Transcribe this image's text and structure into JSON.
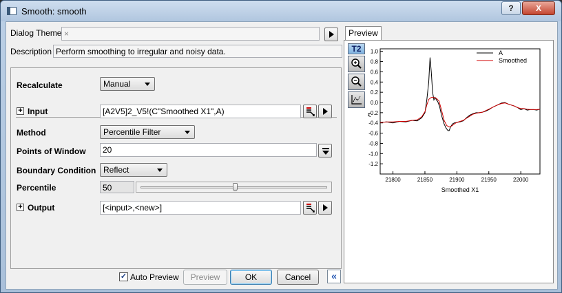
{
  "window": {
    "title": "Smooth: smooth"
  },
  "titlebar": {
    "help_label": "?",
    "close_label": "X"
  },
  "dialog_theme": {
    "label": "Dialog Theme",
    "value": "×"
  },
  "description": {
    "label": "Description",
    "value": "Perform smoothing to irregular and noisy data."
  },
  "recalculate": {
    "label": "Recalculate",
    "value": "Manual"
  },
  "input": {
    "label": "Input",
    "value": "[A2V5]2_V5!(C\"Smoothed X1\",A)"
  },
  "method": {
    "label": "Method",
    "value": "Percentile Filter"
  },
  "points_of_window": {
    "label": "Points of Window",
    "value": "20"
  },
  "boundary": {
    "label": "Boundary Condition",
    "value": "Reflect"
  },
  "percentile": {
    "label": "Percentile",
    "value": "50",
    "slider_fraction": 0.5
  },
  "output": {
    "label": "Output",
    "value": "[<input>,<new>]"
  },
  "footer": {
    "auto_preview_label": "Auto Preview",
    "auto_preview_checked": true,
    "preview_label": "Preview",
    "ok_label": "OK",
    "cancel_label": "Cancel",
    "collapse_label": "«"
  },
  "preview": {
    "tab_label": "Preview",
    "t2_label": "T2"
  },
  "colors": {
    "series_a": "#000000",
    "series_smoothed": "#d00000"
  },
  "chart_data": {
    "type": "line",
    "xlabel": "Smoothed X1",
    "ylabel": "A",
    "xlim": [
      21780,
      22030
    ],
    "ylim": [
      -1.4,
      1.05
    ],
    "xticks": [
      21800,
      21850,
      21900,
      21950,
      22000
    ],
    "yticks": [
      1.0,
      0.8,
      0.6,
      0.4,
      0.2,
      0.0,
      -0.2,
      -0.4,
      -0.6,
      -0.8,
      -1.0,
      -1.2
    ],
    "legend_position": "top-right",
    "series": [
      {
        "name": "A",
        "x": [
          21780,
          21790,
          21800,
          21810,
          21820,
          21830,
          21838,
          21845,
          21850,
          21853,
          21856,
          21858,
          21860,
          21862,
          21864,
          21866,
          21868,
          21870,
          21873,
          21876,
          21880,
          21883,
          21886,
          21888,
          21890,
          21893,
          21896,
          21900,
          21905,
          21910,
          21915,
          21920,
          21925,
          21930,
          21935,
          21940,
          21945,
          21950,
          21955,
          21960,
          21965,
          21970,
          21975,
          21980,
          21985,
          21990,
          21995,
          22000,
          22005,
          22010,
          22015,
          22020,
          22025,
          22030
        ],
        "y": [
          -0.39,
          -0.38,
          -0.4,
          -0.37,
          -0.38,
          -0.35,
          -0.36,
          -0.3,
          -0.2,
          0.05,
          0.4,
          0.88,
          0.6,
          0.2,
          0.05,
          0.1,
          0.05,
          0.02,
          -0.08,
          -0.25,
          -0.42,
          -0.5,
          -0.55,
          -0.55,
          -0.48,
          -0.42,
          -0.4,
          -0.39,
          -0.38,
          -0.36,
          -0.3,
          -0.25,
          -0.22,
          -0.2,
          -0.2,
          -0.19,
          -0.17,
          -0.14,
          -0.1,
          -0.07,
          -0.04,
          -0.01,
          0.0,
          -0.03,
          -0.05,
          -0.07,
          -0.1,
          -0.14,
          -0.12,
          -0.15,
          -0.14,
          -0.14,
          -0.15,
          -0.13
        ]
      },
      {
        "name": "Smoothed",
        "x": [
          21780,
          21790,
          21800,
          21810,
          21820,
          21830,
          21838,
          21845,
          21850,
          21853,
          21856,
          21860,
          21864,
          21868,
          21872,
          21876,
          21880,
          21884,
          21888,
          21892,
          21896,
          21900,
          21905,
          21910,
          21915,
          21920,
          21925,
          21930,
          21935,
          21940,
          21945,
          21950,
          21955,
          21960,
          21965,
          21970,
          21975,
          21980,
          21985,
          21990,
          21995,
          22000,
          22005,
          22010,
          22015,
          22020,
          22025,
          22030
        ],
        "y": [
          -0.39,
          -0.38,
          -0.38,
          -0.37,
          -0.37,
          -0.35,
          -0.34,
          -0.28,
          -0.18,
          -0.05,
          0.06,
          0.1,
          0.1,
          0.08,
          0.03,
          -0.15,
          -0.35,
          -0.45,
          -0.48,
          -0.46,
          -0.42,
          -0.39,
          -0.37,
          -0.35,
          -0.31,
          -0.27,
          -0.23,
          -0.21,
          -0.2,
          -0.19,
          -0.16,
          -0.13,
          -0.1,
          -0.07,
          -0.04,
          -0.02,
          -0.01,
          -0.03,
          -0.05,
          -0.07,
          -0.1,
          -0.12,
          -0.12,
          -0.13,
          -0.14,
          -0.14,
          -0.14,
          -0.13
        ]
      }
    ]
  }
}
